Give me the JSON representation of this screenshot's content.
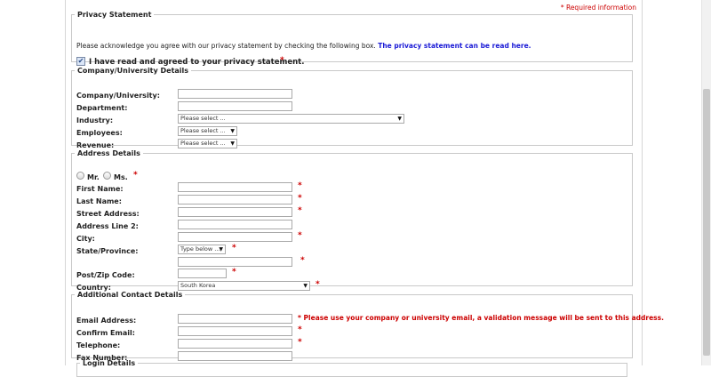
{
  "required_note": "* Required information",
  "privacy": {
    "legend": "Privacy Statement",
    "text": "Please acknowledge you agree with our privacy statement by checking the following box.",
    "link": "The privacy statement can be read here.",
    "checkbox_label": "I have read and agreed to your privacy statement.",
    "checkbox_checked": true,
    "checkbox_mark": "✔"
  },
  "company": {
    "legend": "Company/University Details",
    "company_label": "Company/University:",
    "department_label": "Department:",
    "industry_label": "Industry:",
    "industry_value": "Please select ...",
    "employees_label": "Employees:",
    "employees_value": "Please select ...",
    "revenue_label": "Revenue:",
    "revenue_value": "Please select ..."
  },
  "address": {
    "legend": "Address Details",
    "mr_label": "Mr.",
    "ms_label": "Ms.",
    "first_name_label": "First Name:",
    "last_name_label": "Last Name:",
    "street_label": "Street Address:",
    "line2_label": "Address Line 2:",
    "city_label": "City:",
    "state_label": "State/Province:",
    "state_value": "Type below ...",
    "zip_label": "Post/Zip Code:",
    "country_label": "Country:",
    "country_value": "South Korea"
  },
  "contact": {
    "legend": "Additional Contact Details",
    "email_label": "Email Address:",
    "email_note": "* Please use your company or university email, a validation message will be sent to this address.",
    "confirm_label": "Confirm Email:",
    "phone_label": "Telephone:",
    "fax_label": "Fax Number:"
  },
  "login": {
    "legend": "Login Details"
  },
  "glyphs": {
    "required": "*",
    "dropdown_arrow": "▼"
  },
  "colors": {
    "required": "#cc0000",
    "link": "#1a1ad6",
    "border": "#c9c9c9"
  }
}
